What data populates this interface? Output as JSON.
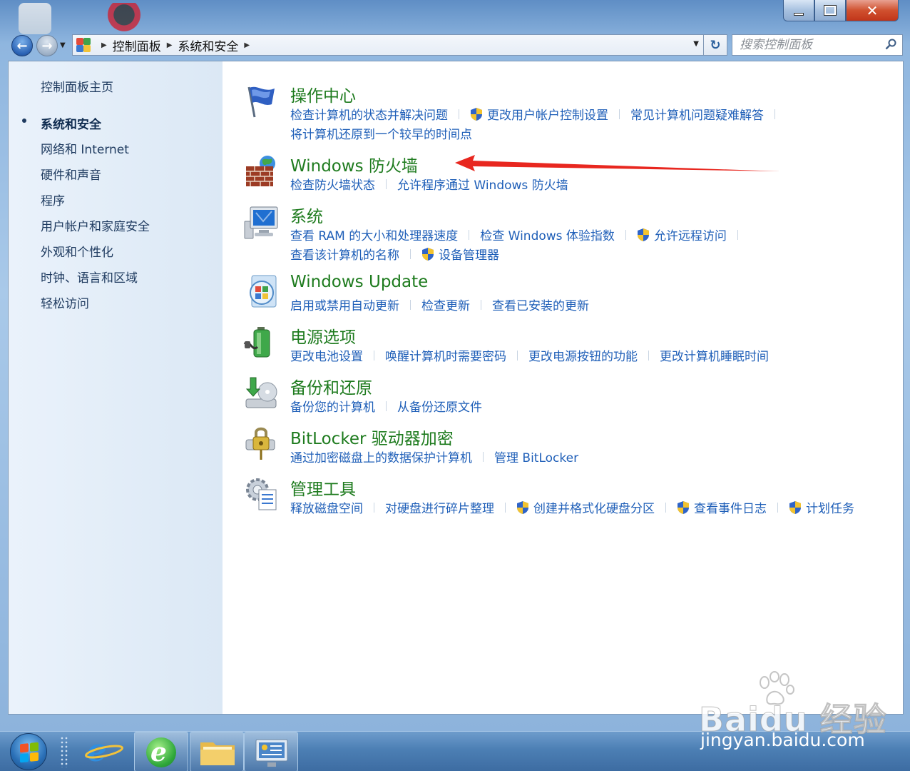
{
  "window": {
    "caption": {
      "minimize": "",
      "maximize": "",
      "close": "✕"
    }
  },
  "breadcrumb": [
    "控制面板",
    "系统和安全"
  ],
  "search": {
    "placeholder": "搜索控制面板"
  },
  "sidebar": {
    "home": "控制面板主页",
    "items": [
      {
        "label": "系统和安全",
        "current": true
      },
      {
        "label": "网络和 Internet"
      },
      {
        "label": "硬件和声音"
      },
      {
        "label": "程序"
      },
      {
        "label": "用户帐户和家庭安全"
      },
      {
        "label": "外观和个性化"
      },
      {
        "label": "时钟、语言和区域"
      },
      {
        "label": "轻松访问"
      }
    ]
  },
  "categories": [
    {
      "title": "操作中心",
      "icon": "action-center-flag-icon",
      "rows": [
        [
          {
            "label": "检查计算机的状态并解决问题"
          },
          {
            "label": "更改用户帐户控制设置",
            "shield": true
          },
          {
            "label": "常见计算机问题疑难解答"
          }
        ],
        [
          {
            "label": "将计算机还原到一个较早的时间点"
          }
        ]
      ]
    },
    {
      "title": "Windows 防火墙",
      "icon": "firewall-brick-icon",
      "rows": [
        [
          {
            "label": "检查防火墙状态"
          },
          {
            "label": "允许程序通过 Windows 防火墙"
          }
        ]
      ]
    },
    {
      "title": "系统",
      "icon": "system-computer-icon",
      "rows": [
        [
          {
            "label": "查看 RAM 的大小和处理器速度"
          },
          {
            "label": "检查 Windows 体验指数"
          },
          {
            "label": "允许远程访问",
            "shield": true
          }
        ],
        [
          {
            "label": "查看该计算机的名称"
          },
          {
            "label": "设备管理器",
            "shield": true
          }
        ]
      ]
    },
    {
      "title": "Windows Update",
      "icon": "windows-update-icon",
      "rows": [
        [
          {
            "label": "启用或禁用自动更新"
          },
          {
            "label": "检查更新"
          },
          {
            "label": "查看已安装的更新"
          }
        ]
      ]
    },
    {
      "title": "电源选项",
      "icon": "power-options-battery-icon",
      "rows": [
        [
          {
            "label": "更改电池设置"
          },
          {
            "label": "唤醒计算机时需要密码"
          },
          {
            "label": "更改电源按钮的功能"
          },
          {
            "label": "更改计算机睡眠时间"
          }
        ]
      ]
    },
    {
      "title": "备份和还原",
      "icon": "backup-restore-icon",
      "rows": [
        [
          {
            "label": "备份您的计算机"
          },
          {
            "label": "从备份还原文件"
          }
        ]
      ]
    },
    {
      "title": "BitLocker 驱动器加密",
      "icon": "bitlocker-lock-icon",
      "rows": [
        [
          {
            "label": "通过加密磁盘上的数据保护计算机"
          },
          {
            "label": "管理 BitLocker"
          }
        ]
      ]
    },
    {
      "title": "管理工具",
      "icon": "admin-tools-icon",
      "rows": [
        [
          {
            "label": "释放磁盘空间"
          },
          {
            "label": "对硬盘进行碎片整理"
          },
          {
            "label": "创建并格式化硬盘分区",
            "shield": true
          },
          {
            "label": "查看事件日志",
            "shield": true
          },
          {
            "label": "计划任务",
            "shield": true
          }
        ]
      ]
    }
  ],
  "taskbar": {
    "buttons": [
      "internet-explorer-icon",
      "ie-green-icon",
      "windows-explorer-icon",
      "control-panel-icon"
    ]
  },
  "watermark": {
    "brand": "Baidu 经验",
    "url": "jingyan.baidu.com"
  },
  "colors": {
    "category_title": "#1e7b1e",
    "link": "#1f5fb8",
    "sidebar_text": "#1e3a5f",
    "annotation_arrow": "#e8271f"
  }
}
